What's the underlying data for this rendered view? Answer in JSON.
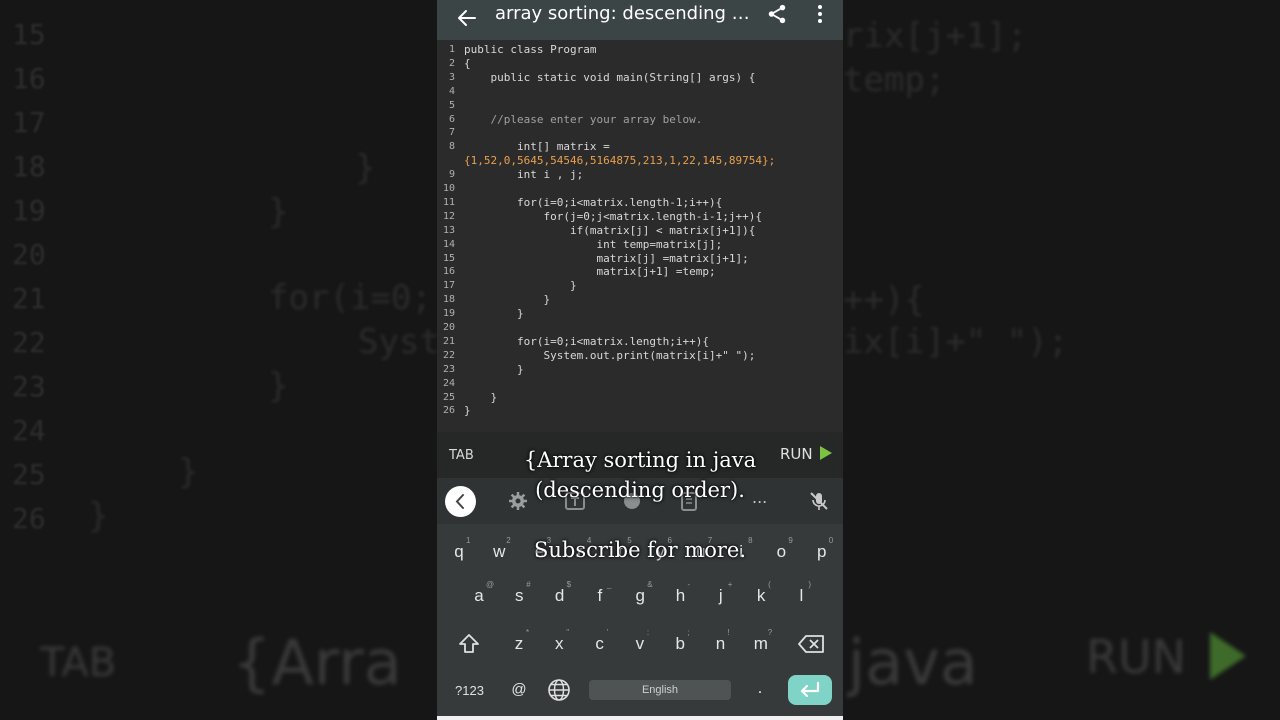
{
  "app": {
    "title": "array sorting: descending o...",
    "back_icon": "arrow-left-icon",
    "share_icon": "share-icon",
    "more_icon": "more-vertical-icon"
  },
  "code_lines": [
    {
      "n": "1",
      "text": "public class Program"
    },
    {
      "n": "2",
      "text": "{"
    },
    {
      "n": "3",
      "text": "    public static void main(String[] args) {"
    },
    {
      "n": "4",
      "text": ""
    },
    {
      "n": "5",
      "text": ""
    },
    {
      "n": "6",
      "text": "    //please enter your array below."
    },
    {
      "n": "7",
      "text": ""
    },
    {
      "n": "8",
      "text": "        int[] matrix ="
    },
    {
      "n": "",
      "text": "{1,52,0,5645,54546,5164875,213,1,22,145,89754};"
    },
    {
      "n": "9",
      "text": "        int i , j;"
    },
    {
      "n": "10",
      "text": ""
    },
    {
      "n": "11",
      "text": "        for(i=0;i<matrix.length-1;i++){"
    },
    {
      "n": "12",
      "text": "            for(j=0;j<matrix.length-i-1;j++){"
    },
    {
      "n": "13",
      "text": "                if(matrix[j] < matrix[j+1]){"
    },
    {
      "n": "14",
      "text": "                    int temp=matrix[j];"
    },
    {
      "n": "15",
      "text": "                    matrix[j] =matrix[j+1];"
    },
    {
      "n": "16",
      "text": "                    matrix[j+1] =temp;"
    },
    {
      "n": "17",
      "text": "                }"
    },
    {
      "n": "18",
      "text": "            }"
    },
    {
      "n": "19",
      "text": "        }"
    },
    {
      "n": "20",
      "text": ""
    },
    {
      "n": "21",
      "text": "        for(i=0;i<matrix.length;i++){"
    },
    {
      "n": "22",
      "text": "            System.out.print(matrix[i]+\" \");"
    },
    {
      "n": "23",
      "text": "        }"
    },
    {
      "n": "24",
      "text": ""
    },
    {
      "n": "25",
      "text": "    }"
    },
    {
      "n": "26",
      "text": "}"
    }
  ],
  "toolbar": {
    "tab_label": "TAB",
    "run_label": "RUN",
    "run_icon": "play-icon"
  },
  "captions": {
    "line1": "{Array sorting in java",
    "line2": "(descending order).",
    "line3": "Subscribe for more."
  },
  "keyboard": {
    "row1": [
      {
        "k": "q",
        "h": "1"
      },
      {
        "k": "w",
        "h": "2"
      },
      {
        "k": "e",
        "h": "3"
      },
      {
        "k": "r",
        "h": "4"
      },
      {
        "k": "t",
        "h": "5"
      },
      {
        "k": "y",
        "h": "6"
      },
      {
        "k": "u",
        "h": "7"
      },
      {
        "k": "i",
        "h": "8"
      },
      {
        "k": "o",
        "h": "9"
      },
      {
        "k": "p",
        "h": "0"
      }
    ],
    "row2": [
      {
        "k": "a",
        "h": "@"
      },
      {
        "k": "s",
        "h": "#"
      },
      {
        "k": "d",
        "h": "$"
      },
      {
        "k": "f",
        "h": "_"
      },
      {
        "k": "g",
        "h": "&"
      },
      {
        "k": "h",
        "h": "-"
      },
      {
        "k": "j",
        "h": "+"
      },
      {
        "k": "k",
        "h": "("
      },
      {
        "k": "l",
        "h": ")"
      }
    ],
    "row3": [
      {
        "k": "z",
        "h": "*"
      },
      {
        "k": "x",
        "h": "\""
      },
      {
        "k": "c",
        "h": "'"
      },
      {
        "k": "v",
        "h": ":"
      },
      {
        "k": "b",
        "h": ";"
      },
      {
        "k": "n",
        "h": "!"
      },
      {
        "k": "m",
        "h": "?"
      }
    ],
    "sym_label": "?123",
    "at_label": "@",
    "space_label": "English",
    "period_label": ".",
    "more_label": "..."
  },
  "background": {
    "nums": [
      "15",
      "16",
      "17",
      "18",
      "19",
      "20",
      "21",
      "22",
      "23",
      "24",
      "25",
      "26"
    ],
    "right_lines": [
      "rix[j+1];",
      "temp;",
      "++){",
      "ix[i]+\" \");"
    ],
    "left_lines": [
      "}",
      "}",
      "for(i=0;",
      "Syst",
      "}",
      "}",
      "}"
    ],
    "bottom_tab": "TAB",
    "bottom_arr": "{Arra",
    "bottom_java": "java",
    "bottom_run": "RUN"
  }
}
